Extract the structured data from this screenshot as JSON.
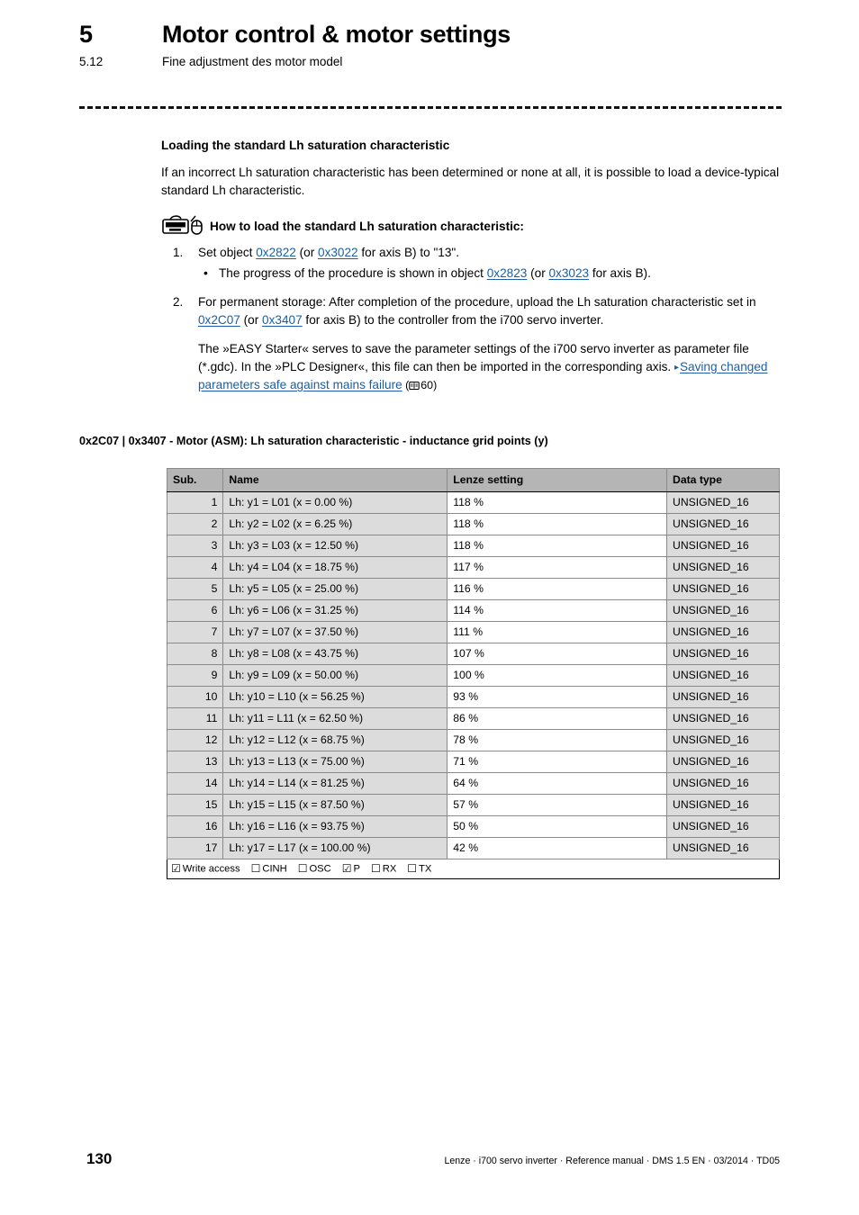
{
  "header": {
    "chapter_number": "5",
    "chapter_title": "Motor control & motor settings",
    "section_number": "5.12",
    "section_title": "Fine adjustment des motor model"
  },
  "content": {
    "heading": "Loading the standard Lh saturation characteristic",
    "intro": "If an incorrect Lh saturation characteristic has been determined or none at all, it is possible to load a device-typical standard Lh characteristic.",
    "howto_icon": "keyboard-mouse-icon",
    "howto_title": "How to load the standard Lh saturation characteristic:",
    "step1": {
      "marker": "1.",
      "text_a": "Set object ",
      "link1": "0x2822",
      "text_b": " (or ",
      "link2": "0x3022",
      "text_c": " for axis B) to \"13\".",
      "substep": {
        "bullet": "•",
        "text_a": "The progress of the procedure is shown in object ",
        "link1": "0x2823",
        "text_b": " (or ",
        "link2": "0x3023",
        "text_c": " for axis B)."
      }
    },
    "step2": {
      "marker": "2.",
      "text_a": "For permanent storage: After completion of the procedure, upload the Lh saturation characteristic set in ",
      "link1": "0x2C07",
      "text_b": " (or ",
      "link2": "0x3407",
      "text_c": " for axis B) to the controller from the i700 servo inverter.",
      "note_a": "The »EASY Starter« serves to save the parameter settings of the i700 servo inverter as parameter file (*.gdc). In the »PLC Designer«, this file can then be imported in the corresponding axis. ",
      "note_arrow": "▸",
      "note_link": "Saving changed parameters safe against mains failure",
      "note_ref_open": " (",
      "note_ref_icon": "book-icon",
      "note_ref_page": "60",
      "note_ref_close": ")"
    }
  },
  "table": {
    "caption": "0x2C07 | 0x3407 - Motor (ASM): Lh saturation characteristic - inductance grid points (y)",
    "columns": [
      "Sub.",
      "Name",
      "Lenze setting",
      "Data type"
    ],
    "rows": [
      {
        "sub": "1",
        "name": "Lh: y1 = L01 (x = 0.00 %)",
        "setting": "118 %",
        "type": "UNSIGNED_16"
      },
      {
        "sub": "2",
        "name": "Lh: y2 = L02 (x = 6.25 %)",
        "setting": "118 %",
        "type": "UNSIGNED_16"
      },
      {
        "sub": "3",
        "name": "Lh: y3 = L03 (x = 12.50 %)",
        "setting": "118 %",
        "type": "UNSIGNED_16"
      },
      {
        "sub": "4",
        "name": "Lh: y4 = L04 (x = 18.75 %)",
        "setting": "117 %",
        "type": "UNSIGNED_16"
      },
      {
        "sub": "5",
        "name": "Lh: y5 = L05 (x = 25.00 %)",
        "setting": "116 %",
        "type": "UNSIGNED_16"
      },
      {
        "sub": "6",
        "name": "Lh: y6 = L06 (x = 31.25 %)",
        "setting": "114 %",
        "type": "UNSIGNED_16"
      },
      {
        "sub": "7",
        "name": "Lh: y7 = L07 (x = 37.50 %)",
        "setting": "111 %",
        "type": "UNSIGNED_16"
      },
      {
        "sub": "8",
        "name": "Lh: y8 = L08 (x = 43.75 %)",
        "setting": "107 %",
        "type": "UNSIGNED_16"
      },
      {
        "sub": "9",
        "name": "Lh: y9 = L09 (x = 50.00 %)",
        "setting": "100 %",
        "type": "UNSIGNED_16"
      },
      {
        "sub": "10",
        "name": "Lh: y10 = L10 (x = 56.25 %)",
        "setting": "93 %",
        "type": "UNSIGNED_16"
      },
      {
        "sub": "11",
        "name": "Lh: y11 = L11 (x = 62.50 %)",
        "setting": "86 %",
        "type": "UNSIGNED_16"
      },
      {
        "sub": "12",
        "name": "Lh: y12 = L12 (x = 68.75 %)",
        "setting": "78 %",
        "type": "UNSIGNED_16"
      },
      {
        "sub": "13",
        "name": "Lh: y13 = L13 (x = 75.00 %)",
        "setting": "71 %",
        "type": "UNSIGNED_16"
      },
      {
        "sub": "14",
        "name": "Lh: y14 = L14 (x = 81.25 %)",
        "setting": "64 %",
        "type": "UNSIGNED_16"
      },
      {
        "sub": "15",
        "name": "Lh: y15 = L15 (x = 87.50 %)",
        "setting": "57 %",
        "type": "UNSIGNED_16"
      },
      {
        "sub": "16",
        "name": "Lh: y16 = L16 (x = 93.75 %)",
        "setting": "50 %",
        "type": "UNSIGNED_16"
      },
      {
        "sub": "17",
        "name": "Lh: y17 = L17 (x = 100.00 %)",
        "setting": "42 %",
        "type": "UNSIGNED_16"
      }
    ],
    "access": [
      {
        "label": "Write access",
        "checked": true
      },
      {
        "label": "CINH",
        "checked": false
      },
      {
        "label": "OSC",
        "checked": false
      },
      {
        "label": "P",
        "checked": true
      },
      {
        "label": "RX",
        "checked": false
      },
      {
        "label": "TX",
        "checked": false
      }
    ],
    "checkbox_checked": "☑",
    "checkbox_unchecked": "☐"
  },
  "footer": {
    "page_number": "130",
    "note": "Lenze · i700 servo inverter · Reference manual · DMS 1.5 EN · 03/2014 · TD05"
  },
  "colors": {
    "link": "#1a5fa8",
    "table_header_bg": "#b5b5b5",
    "table_cell_bg": "#dcdcdc"
  }
}
